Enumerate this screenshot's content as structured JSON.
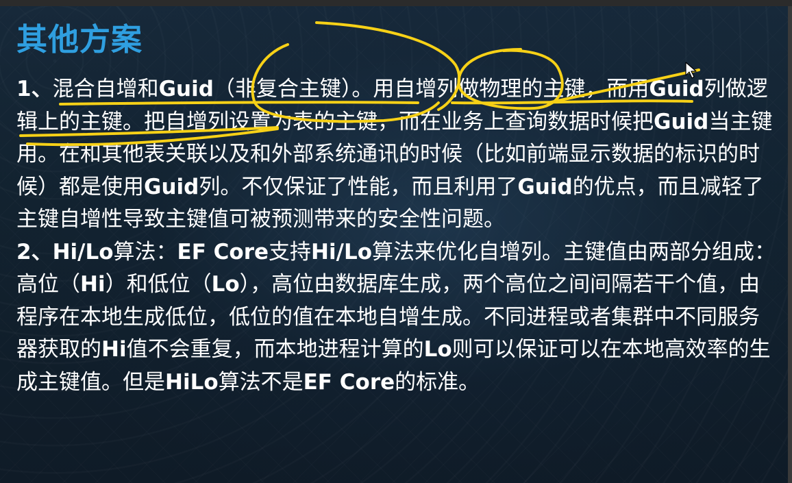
{
  "slide": {
    "title": "其他方案",
    "para1": {
      "num": "1、",
      "t1": "混合自增和",
      "b1": "Guid",
      "t2": "（非复合主键）。用自增列做物理的主键，而用",
      "b2": "Guid",
      "t3": "列做逻辑上的主键。把自增列设置为表的主键，而在业务上查询数据时候把",
      "b3": "Guid",
      "t4": "当主键用。在和其他表关联以及和外部系统通讯的时候（比如前端显示数据的标识的时候）都是使用",
      "b4": "Guid",
      "t5": "列。不仅保证了性能，而且利用了",
      "b5": "Guid",
      "t6": "的优点，而且减轻了主键自增性导致主键值可被预测带来的安全性问题。"
    },
    "para2": {
      "num": "2、",
      "b1": "Hi/Lo",
      "t1": "算法：",
      "b2": "EF Core",
      "t2": "支持",
      "b3": "Hi/Lo",
      "t3": "算法来优化自增列。主键值由两部分组成：高位（",
      "b4": "Hi",
      "t4": "）和低位（",
      "b5": "Lo",
      "t5": "），高位由数据库生成，两个高位之间间隔若干个值，由程序在本地生成低位，低位的值在本地自增生成。不同进程或者集群中不同服务器获取的",
      "b6": "Hi",
      "t6": "值不会重复，而本地进程计算的",
      "b7": "Lo",
      "t7": "则可以保证可以在本地高效率的生成主键值。但是",
      "b8": "HiLo",
      "t8": "算法不是",
      "b9": "EF Core",
      "t9": "的标准。"
    }
  },
  "colors": {
    "title": "#2f9fe0",
    "text": "#ffffff",
    "annotation": "#f7d117",
    "background": "#12222f"
  },
  "icons": {
    "pointer": "mouse-cursor-icon"
  }
}
